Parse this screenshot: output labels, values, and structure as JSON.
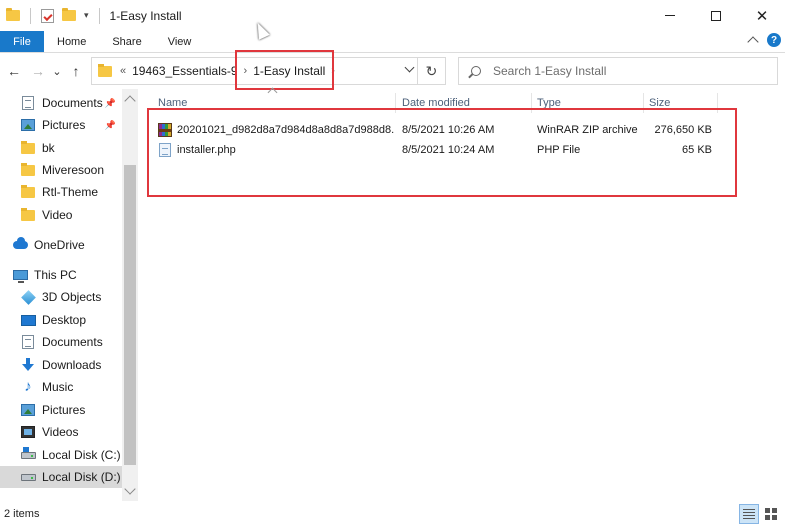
{
  "window": {
    "title": "1-Easy Install"
  },
  "ribbon": {
    "tabs": [
      "File",
      "Home",
      "Share",
      "View"
    ],
    "help_symbol": "?"
  },
  "navigation": {
    "back": "←",
    "forward": "→",
    "recent": "⌄",
    "up": "↑",
    "address": {
      "overflow": "«",
      "crumbs": [
        "19463_Essentials-9",
        "1-Easy Install"
      ],
      "separator": "›",
      "refresh": "↻"
    },
    "search_placeholder": "Search 1-Easy Install"
  },
  "sidebar": {
    "items": [
      {
        "label": "Documents",
        "icon": "documents-icon",
        "pinned": true
      },
      {
        "label": "Pictures",
        "icon": "pictures-icon",
        "pinned": true
      },
      {
        "label": "bk",
        "icon": "folder-icon"
      },
      {
        "label": "Miveresoon",
        "icon": "folder-icon"
      },
      {
        "label": "Rtl-Theme",
        "icon": "folder-icon"
      },
      {
        "label": "Video",
        "icon": "folder-icon"
      },
      {
        "label": "OneDrive",
        "icon": "onedrive-icon"
      },
      {
        "label": "This PC",
        "icon": "this-pc-icon"
      },
      {
        "label": "3D Objects",
        "icon": "3d-objects-icon"
      },
      {
        "label": "Desktop",
        "icon": "desktop-icon"
      },
      {
        "label": "Documents",
        "icon": "documents-icon"
      },
      {
        "label": "Downloads",
        "icon": "downloads-icon"
      },
      {
        "label": "Music",
        "icon": "music-icon"
      },
      {
        "label": "Pictures",
        "icon": "pictures-icon"
      },
      {
        "label": "Videos",
        "icon": "videos-icon"
      },
      {
        "label": "Local Disk (C:)",
        "icon": "local-disk-c-icon"
      },
      {
        "label": "Local Disk (D:)",
        "icon": "local-disk-d-icon",
        "selected": true
      }
    ]
  },
  "file_list": {
    "columns": [
      "Name",
      "Date modified",
      "Type",
      "Size"
    ],
    "rows": [
      {
        "name": "20201021_d982d8a7d984d8a8d8a7d988d8...",
        "date": "8/5/2021 10:26 AM",
        "type": "WinRAR ZIP archive",
        "size": "276,650 KB",
        "icon": "winrar-archive-icon"
      },
      {
        "name": "installer.php",
        "date": "8/5/2021 10:24 AM",
        "type": "PHP File",
        "size": "65 KB",
        "icon": "php-file-icon"
      }
    ]
  },
  "status": {
    "item_count": "2 items"
  },
  "colors": {
    "accent": "#1979ca",
    "highlight": "#e0373d",
    "selected": "#d9d9d9"
  }
}
